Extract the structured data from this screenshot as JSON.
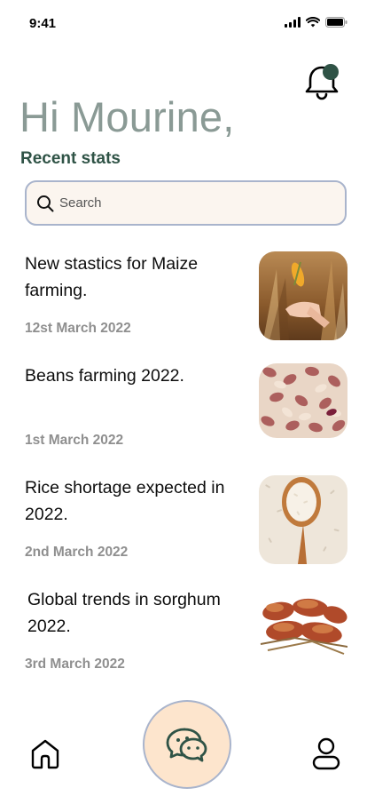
{
  "status_bar": {
    "time": "9:41"
  },
  "header": {
    "greeting": "Hi Mourine,",
    "section_title": "Recent stats"
  },
  "search": {
    "placeholder": "Search",
    "value": ""
  },
  "news": [
    {
      "title": "New stastics for Maize farming.",
      "date": "12st March 2022",
      "image": "maize-photo"
    },
    {
      "title": "Beans farming 2022.",
      "date": "1st March 2022",
      "image": "beans-photo"
    },
    {
      "title": "Rice shortage expected in 2022.",
      "date": "2nd March 2022",
      "image": "rice-photo"
    },
    {
      "title": "Global trends in sorghum 2022.",
      "date": "3rd March 2022",
      "image": "sorghum-photo"
    }
  ],
  "nav": {
    "items": [
      {
        "icon": "home-icon"
      },
      {
        "icon": "chat-icon",
        "active": true
      },
      {
        "icon": "profile-icon"
      }
    ]
  },
  "colors": {
    "accent_green": "#2f5346",
    "greeting_gray": "#8a9a95",
    "search_bg": "#fbf5ef",
    "search_border": "#a9b4cc",
    "chat_bg": "#fde5cd",
    "date_gray": "#8f8f8f"
  }
}
